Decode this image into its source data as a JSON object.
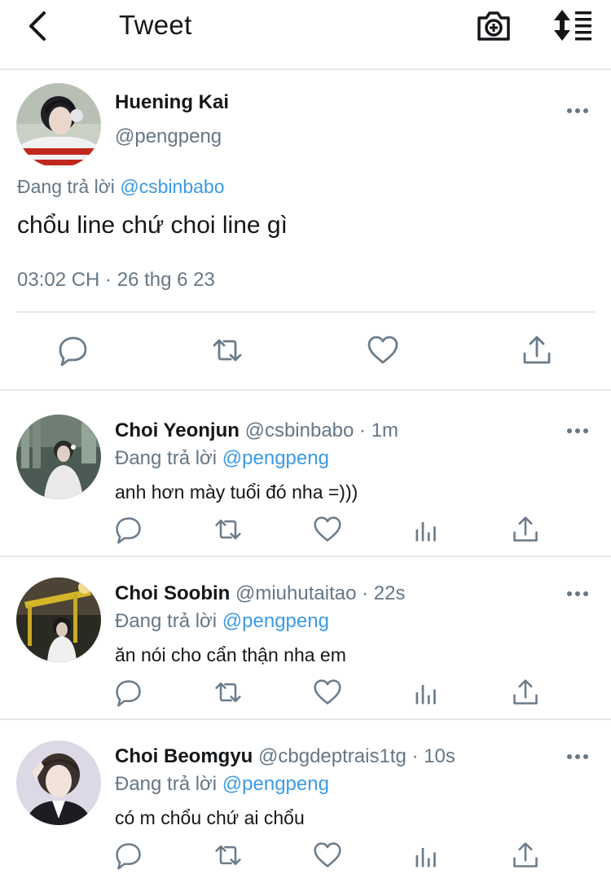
{
  "header": {
    "title": "Tweet"
  },
  "main_tweet": {
    "name": "Huening Kai",
    "handle": "@pengpeng",
    "replying_prefix": "Đang trả lời",
    "replying_to": "@csbinbabo",
    "text": "chổu line chứ choi line gì",
    "timestamp": "03:02 CH · 26 thg 6 23"
  },
  "replies": [
    {
      "name": "Choi Yeonjun",
      "handle": "@csbinbabo",
      "time": "1m",
      "replying_prefix": "Đang trả lời",
      "replying_to": "@pengpeng",
      "text": "anh hơn mày tuổi đó nha =)))"
    },
    {
      "name": "Choi Soobin",
      "handle": "@miuhutaitao",
      "time": "22s",
      "replying_prefix": "Đang trả lời",
      "replying_to": "@pengpeng",
      "text": "ăn nói cho cẩn thận nha em"
    },
    {
      "name": "Choi Beomgyu",
      "handle": "@cbgdeptrais1tg",
      "time": "10s",
      "replying_prefix": "Đang trả lời",
      "replying_to": "@pengpeng",
      "text": "có m chổu chứ ai chổu"
    }
  ],
  "colors": {
    "accent": "#3b9be3",
    "muted": "#657786",
    "icon": "#6b7b8a",
    "divider": "#e6e9eb"
  }
}
